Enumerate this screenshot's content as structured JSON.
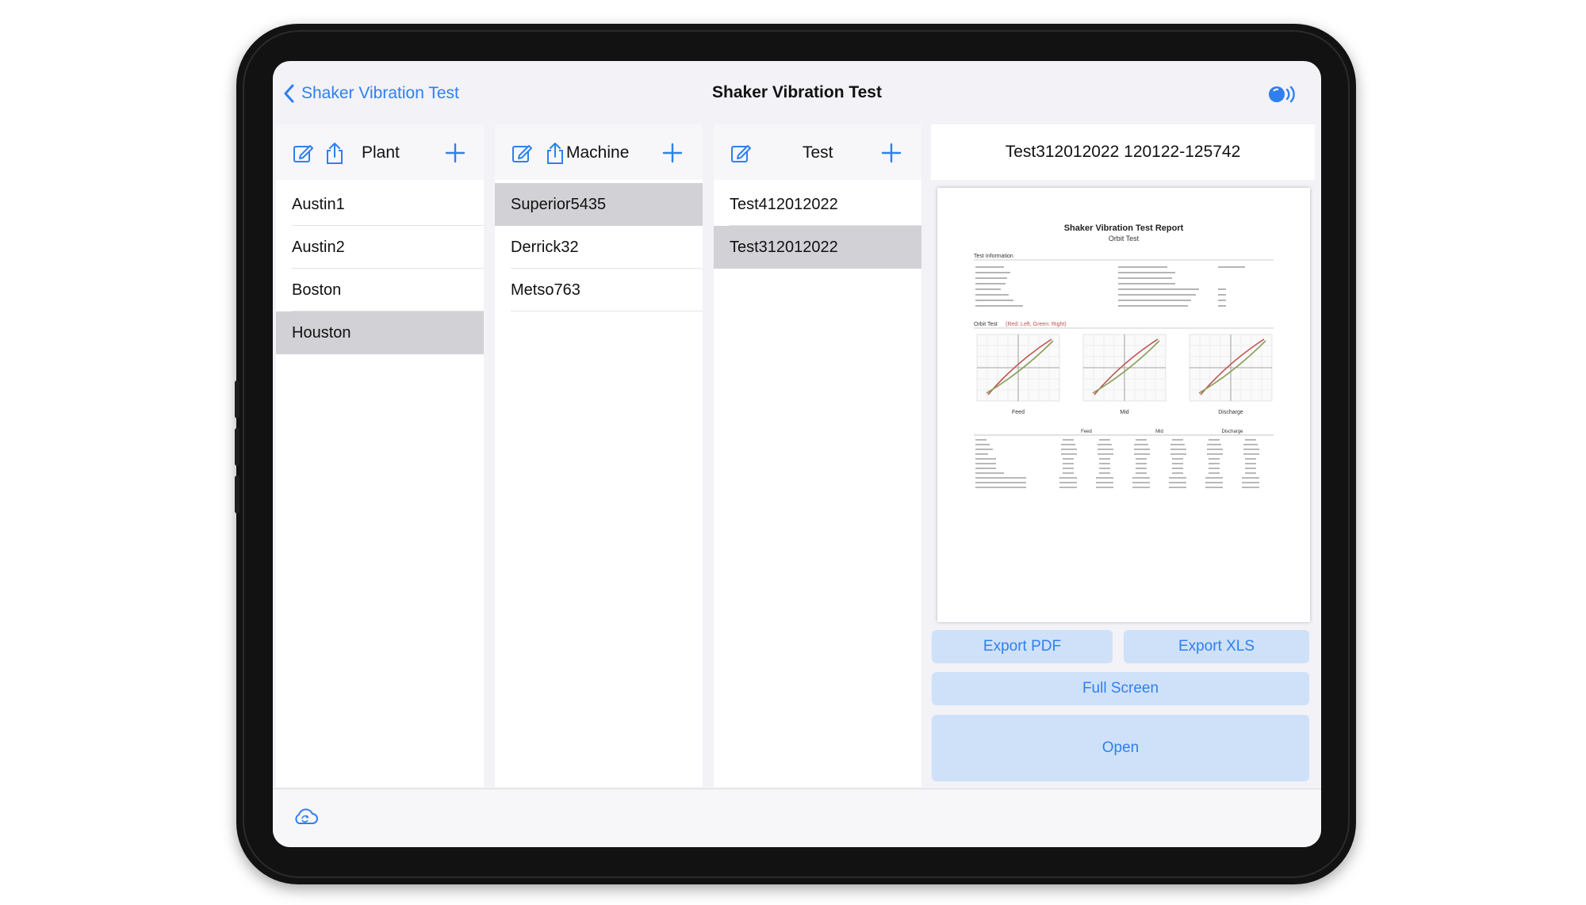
{
  "nav": {
    "back_label": "Shaker Vibration Test",
    "title": "Shaker Vibration Test",
    "right_icon": "broadcast-icon"
  },
  "plant": {
    "title": "Plant",
    "items": [
      "Austin1",
      "Austin2",
      "Boston",
      "Houston"
    ],
    "selected": "Houston"
  },
  "machine": {
    "title": "Machine",
    "items": [
      "Superior5435",
      "Derrick32",
      "Metso763"
    ],
    "selected": "Superior5435"
  },
  "test": {
    "title": "Test",
    "items": [
      "Test412012022",
      "Test312012022"
    ],
    "selected": "Test312012022"
  },
  "detail": {
    "title": "Test312012022 120122-125742",
    "report": {
      "title": "Shaker Vibration Test Report",
      "subtitle": "Orbit Test",
      "section_info": "Test Information",
      "section_orbit": "Orbit Test",
      "orbit_legend": "(Red: Left, Green: Right)",
      "plot_labels": [
        "Feed",
        "Mid",
        "Discharge"
      ],
      "table_groups": [
        "Feed",
        "Mid",
        "Discharge"
      ]
    },
    "buttons": {
      "export_pdf": "Export PDF",
      "export_xls": "Export XLS",
      "full_screen": "Full Screen",
      "open": "Open"
    }
  },
  "toolbar": {
    "icon": "cloud-sync-icon"
  },
  "colors": {
    "accent": "#2f7ff0",
    "button_bg": "#cfe1f9",
    "selected_row": "#d1d1d6",
    "device_frame": "#121212"
  }
}
